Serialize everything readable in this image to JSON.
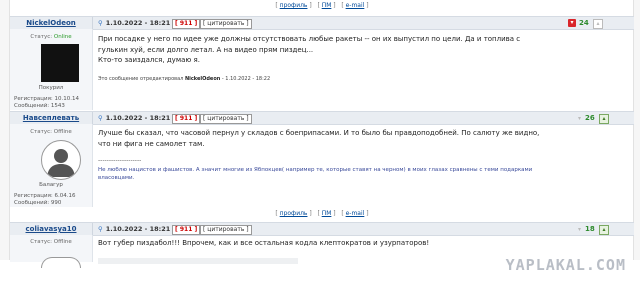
{
  "actions": {
    "profile": "профиль",
    "pm": "ПМ",
    "email": "e-mail"
  },
  "posts": [
    {
      "author": "NickelOdeon",
      "status_label": "Статус:",
      "status_value": "Online",
      "avatar_kind": "black-square",
      "rank": "Покурил",
      "reg_label": "Регистрация:",
      "reg_date": "10.10.14",
      "msgs_label": "Сообщений:",
      "msgs": "1543",
      "datetime": "1.10.2022 - 18:21",
      "post_num": "911",
      "cite": "цитировать",
      "rating": "24",
      "lines": [
        "При посадке у него по идее уже должны отсутствовать любые ракеты -- он их выпустил по цели. Да и топлива с",
        "гулькин хуй, если долго летал. А на видео прям пиздец...",
        "Кто-то заиздался, думаю я."
      ],
      "edited_prefix": "Это сообщение отредактировал",
      "edited_by": "NickelOdeon",
      "edited_when": "- 1.10.2022 - 18:22"
    },
    {
      "author": "Навсеплевать",
      "status_label": "Статус:",
      "status_value": "Offline",
      "avatar_kind": "user-silhouette",
      "rank": "Балагур",
      "reg_label": "Регистрация:",
      "reg_date": "6.04.16",
      "msgs_label": "Сообщений:",
      "msgs": "990",
      "datetime": "1.10.2022 - 18:21",
      "post_num": "911",
      "cite": "цитировать",
      "rating": "26",
      "lines": [
        "Лучше бы сказал, что часовой пернул у складов с боеприпасами. И то было бы правдоподобней. По салюту же видно,",
        "что ни фига не самолет там."
      ],
      "sig_dash": "--------------------",
      "sig_lines": [
        "Не люблю нацистов и фашистов. А значит многие из Ябпокцев( например те, которые ставят на черном) в моих глазах сравнены с теми подарками",
        "власовцами."
      ]
    },
    {
      "author": "coliavasya10",
      "status_label": "Статус:",
      "status_value": "Offline",
      "datetime": "1.10.2022 - 18:21",
      "post_num": "911",
      "cite": "цитировать",
      "rating": "18",
      "lines": [
        "Вот губер пиздабол!!! Впрочем, как и все остальная кодла клептократов и узурпаторов!"
      ]
    }
  ],
  "watermark": "YAPLAKAL.COM",
  "colors": {
    "header_bg": "#e9edf2",
    "online": "#2a9a2a",
    "rating": "#2d8a2d",
    "name": "#1a4a8a"
  }
}
